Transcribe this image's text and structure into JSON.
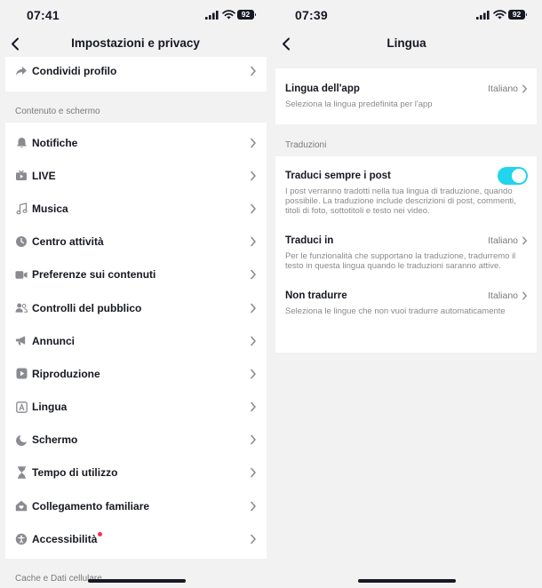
{
  "left": {
    "status": {
      "time": "07:41",
      "battery": "92"
    },
    "nav": {
      "title": "Impostazioni e privacy"
    },
    "top_item": {
      "label": "Condividi profilo",
      "icon": "share-arrow-icon"
    },
    "section1": "Contenuto e schermo",
    "items": [
      {
        "label": "Notifiche",
        "icon": "bell-icon"
      },
      {
        "label": "LIVE",
        "icon": "live-tv-icon"
      },
      {
        "label": "Musica",
        "icon": "music-note-icon"
      },
      {
        "label": "Centro attività",
        "icon": "clock-icon"
      },
      {
        "label": "Preferenze sui contenuti",
        "icon": "video-camera-icon"
      },
      {
        "label": "Controlli del pubblico",
        "icon": "people-icon"
      },
      {
        "label": "Annunci",
        "icon": "megaphone-icon"
      },
      {
        "label": "Riproduzione",
        "icon": "play-icon"
      },
      {
        "label": "Lingua",
        "icon": "language-a-icon"
      },
      {
        "label": "Schermo",
        "icon": "moon-icon"
      },
      {
        "label": "Tempo di utilizzo",
        "icon": "hourglass-icon"
      },
      {
        "label": "Collegamento familiare",
        "icon": "home-heart-icon"
      },
      {
        "label": "Accessibilità",
        "icon": "accessibility-icon",
        "badge": true
      }
    ],
    "section2": "Cache e Dati cellulare"
  },
  "right": {
    "status": {
      "time": "07:39",
      "battery": "92"
    },
    "nav": {
      "title": "Lingua"
    },
    "app_language": {
      "name": "Lingua dell'app",
      "value": "Italiano",
      "desc": "Seleziona la lingua predefinita per l'app"
    },
    "section": "Traduzioni",
    "translate_always": {
      "name": "Traduci sempre i post",
      "enabled": true,
      "desc": "I post verranno tradotti nella tua lingua di traduzione, quando possibile. La traduzione include descrizioni di post, commenti, titoli di foto, sottotitoli e testo nei video."
    },
    "translate_to": {
      "name": "Traduci in",
      "value": "Italiano",
      "desc": "Per le funzionalità che supportano la traduzione, tradurremo il testo in questa lingua quando le traduzioni saranno attive."
    },
    "dont_translate": {
      "name": "Non tradurre",
      "value": "Italiano",
      "desc": "Seleziona le lingue che non vuoi tradurre automaticamente"
    }
  },
  "colors": {
    "accent": "#20d5ec",
    "badge": "#fe2c55",
    "background": "#f2f2f2",
    "text": "#161823",
    "secondary": "#7a7a7a"
  }
}
